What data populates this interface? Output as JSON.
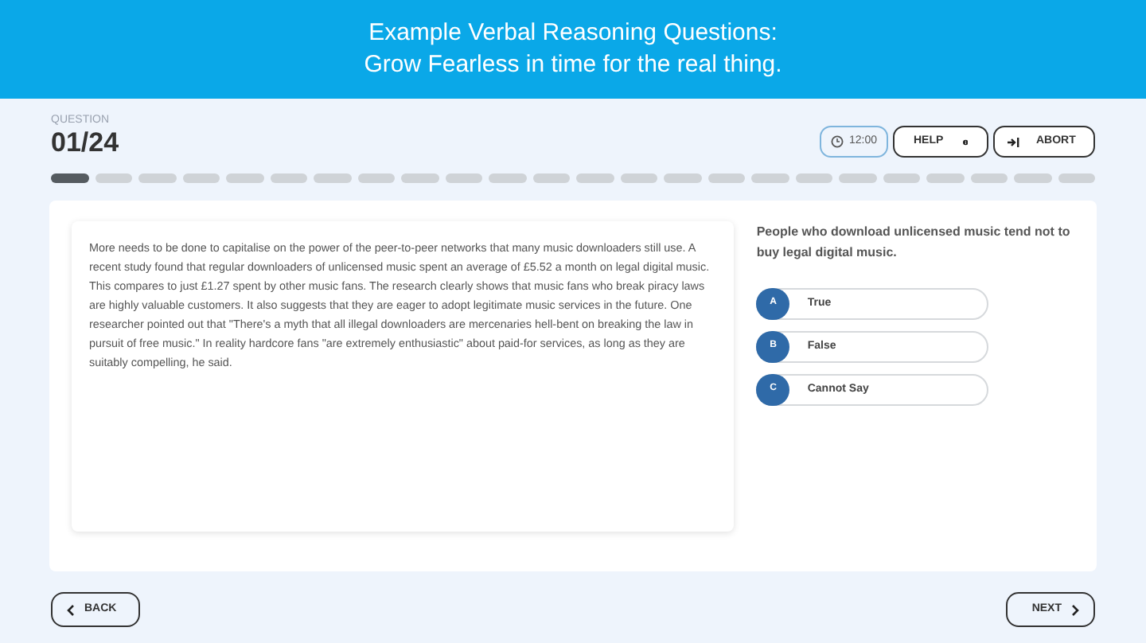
{
  "header": {
    "title_lines": [
      "Example Verbal Reasoning Questions:",
      "Grow Fearless in time for the real thing."
    ]
  },
  "question_label": "QUESTION",
  "question_number": "01/24",
  "timer": "12:00",
  "help_button": "HELP",
  "abort_button": "ABORT",
  "progress": [
    {
      "current": true
    },
    {
      "current": false
    },
    {
      "current": false
    },
    {
      "current": false
    },
    {
      "current": false
    },
    {
      "current": false
    },
    {
      "current": false
    },
    {
      "current": false
    },
    {
      "current": false
    },
    {
      "current": false
    },
    {
      "current": false
    },
    {
      "current": false
    },
    {
      "current": false
    },
    {
      "current": false
    },
    {
      "current": false
    },
    {
      "current": false
    },
    {
      "current": false
    },
    {
      "current": false
    },
    {
      "current": false
    },
    {
      "current": false
    },
    {
      "current": false
    },
    {
      "current": false
    },
    {
      "current": false
    },
    {
      "current": false
    }
  ],
  "passage": "More needs to be done to capitalise on the power of the peer-to-peer networks that many music downloaders still use. A recent study found that regular downloaders of unlicensed music spent an average of £5.52 a month on legal digital music. This compares to just £1.27 spent by other music fans. The research clearly shows that music fans who break piracy laws are highly valuable customers. It also suggests that they are eager to adopt legitimate music services in the future. One researcher pointed out that \"There's a myth that all illegal downloaders are mercenaries hell-bent on breaking the law in pursuit of free music.\" In reality hardcore fans \"are extremely enthusiastic\" about paid-for services, as long as they are suitably compelling, he said.",
  "statement": "People who download unlicensed music tend not to buy legal digital music.",
  "options": [
    {
      "letter": "A",
      "label": "True",
      "selected": false
    },
    {
      "letter": "B",
      "label": "False",
      "selected": false
    },
    {
      "letter": "C",
      "label": "Cannot Say",
      "selected": false
    }
  ],
  "back_button": "BACK",
  "next_button": "NEXT"
}
